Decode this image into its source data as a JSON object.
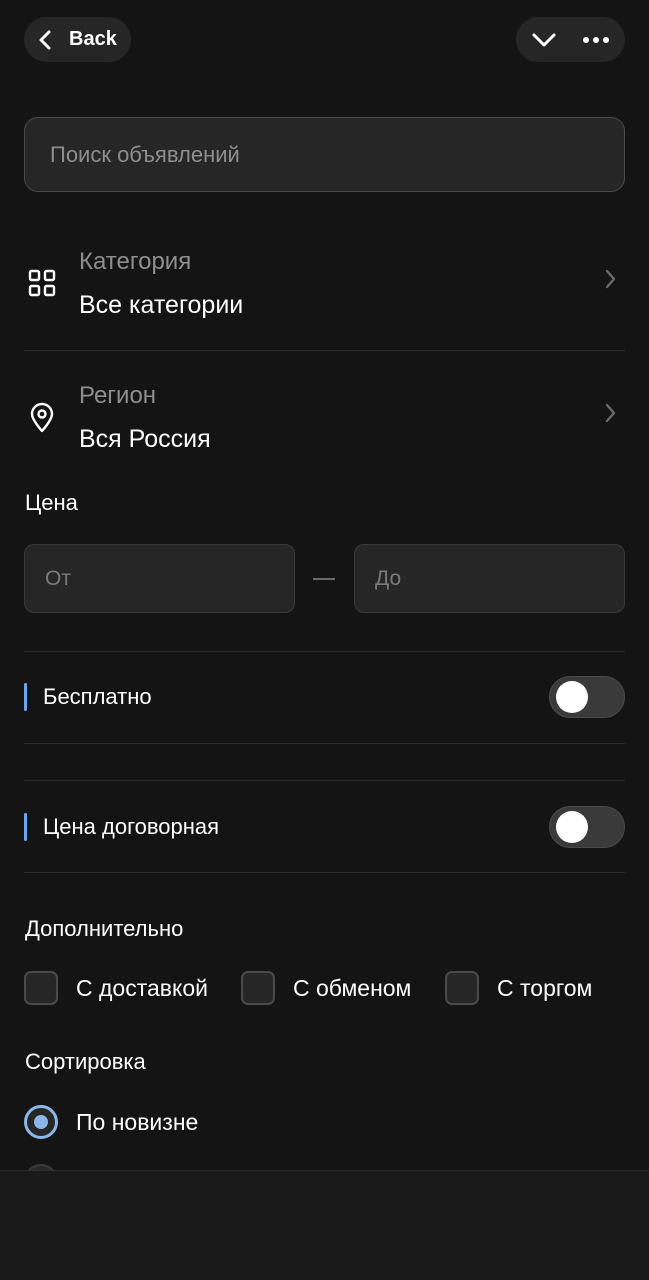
{
  "header": {
    "back_label": "Back",
    "icons": [
      "chevron-left-icon",
      "chevron-down-icon",
      "more-horizontal-icon"
    ]
  },
  "search": {
    "placeholder": "Поиск объявлений",
    "value": ""
  },
  "category": {
    "label": "Категория",
    "value": "Все категории",
    "icon": "grid-icon"
  },
  "region": {
    "label": "Регион",
    "value": "Вся Россия",
    "icon": "location-pin-icon"
  },
  "price": {
    "title": "Цена",
    "from_placeholder": "От",
    "to_placeholder": "До"
  },
  "toggles": {
    "free": {
      "label": "Бесплатно",
      "on": false
    },
    "negotiable": {
      "label": "Цена договорная",
      "on": false
    }
  },
  "extra": {
    "title": "Дополнительно",
    "options": [
      "С доставкой",
      "С обменом",
      "С торгом"
    ]
  },
  "sort": {
    "title": "Сортировка",
    "selected": "По новизне"
  },
  "colors": {
    "background": "#141414",
    "surface": "#262626",
    "accent": "#8ab8ea",
    "muted_text": "#8e8e8e"
  }
}
